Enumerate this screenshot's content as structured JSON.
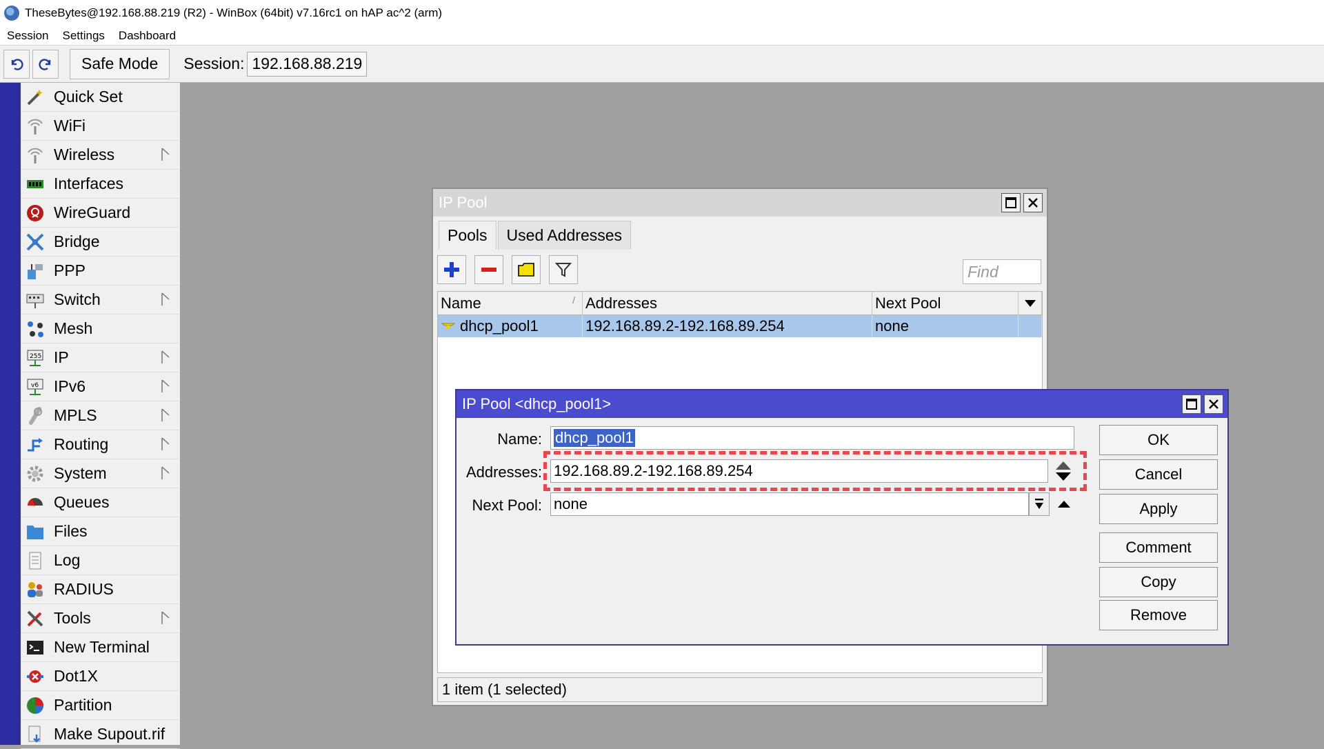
{
  "window": {
    "title": "TheseBytes@192.168.88.219 (R2) - WinBox (64bit) v7.16rc1 on hAP ac^2 (arm)"
  },
  "menu": [
    "Session",
    "Settings",
    "Dashboard"
  ],
  "toolbar": {
    "safe_mode_label": "Safe Mode",
    "session_label": "Session:",
    "session_value": "192.168.88.219"
  },
  "sidebar": {
    "items": [
      {
        "label": "Quick Set",
        "icon": "wand-icon",
        "submenu": false
      },
      {
        "label": "WiFi",
        "icon": "wifi-antenna-icon",
        "submenu": false
      },
      {
        "label": "Wireless",
        "icon": "wireless-antenna-icon",
        "submenu": true
      },
      {
        "label": "Interfaces",
        "icon": "interfaces-icon",
        "submenu": false
      },
      {
        "label": "WireGuard",
        "icon": "wireguard-icon",
        "submenu": false
      },
      {
        "label": "Bridge",
        "icon": "bridge-icon",
        "submenu": false
      },
      {
        "label": "PPP",
        "icon": "ppp-icon",
        "submenu": false
      },
      {
        "label": "Switch",
        "icon": "switch-icon",
        "submenu": true
      },
      {
        "label": "Mesh",
        "icon": "mesh-icon",
        "submenu": false
      },
      {
        "label": "IP",
        "icon": "ip-icon",
        "submenu": true
      },
      {
        "label": "IPv6",
        "icon": "ipv6-icon",
        "submenu": true
      },
      {
        "label": "MPLS",
        "icon": "mpls-icon",
        "submenu": true
      },
      {
        "label": "Routing",
        "icon": "routing-icon",
        "submenu": true
      },
      {
        "label": "System",
        "icon": "gear-icon",
        "submenu": true
      },
      {
        "label": "Queues",
        "icon": "queues-icon",
        "submenu": false
      },
      {
        "label": "Files",
        "icon": "folder-icon",
        "submenu": false
      },
      {
        "label": "Log",
        "icon": "log-icon",
        "submenu": false
      },
      {
        "label": "RADIUS",
        "icon": "radius-users-icon",
        "submenu": false
      },
      {
        "label": "Tools",
        "icon": "tools-icon",
        "submenu": true
      },
      {
        "label": "New Terminal",
        "icon": "terminal-icon",
        "submenu": false
      },
      {
        "label": "Dot1X",
        "icon": "dot1x-icon",
        "submenu": false
      },
      {
        "label": "Partition",
        "icon": "partition-icon",
        "submenu": false
      },
      {
        "label": "Make Supout.rif",
        "icon": "supout-icon",
        "submenu": false
      }
    ]
  },
  "ip_pool_window": {
    "title": "IP Pool",
    "tabs": [
      "Pools",
      "Used Addresses"
    ],
    "active_tab": "Pools",
    "find_placeholder": "Find",
    "columns": [
      "Name",
      "Addresses",
      "Next Pool"
    ],
    "rows": [
      {
        "name": "dhcp_pool1",
        "addresses": "192.168.89.2-192.168.89.254",
        "next_pool": "none",
        "selected": true
      }
    ],
    "status": "1 item (1 selected)"
  },
  "dialog": {
    "title": "IP Pool <dhcp_pool1>",
    "name_label": "Name:",
    "name_value": "dhcp_pool1",
    "addresses_label": "Addresses:",
    "addresses_value": "192.168.89.2-192.168.89.254",
    "next_pool_label": "Next Pool:",
    "next_pool_value": "none",
    "buttons": [
      "OK",
      "Cancel",
      "Apply",
      "Comment",
      "Copy",
      "Remove"
    ]
  },
  "colors": {
    "sidebar_stripe": "#2b2da0",
    "dialog_title": "#4b4bcf",
    "selection": "#a9c7ea",
    "highlight_dash": "#e8474f"
  }
}
